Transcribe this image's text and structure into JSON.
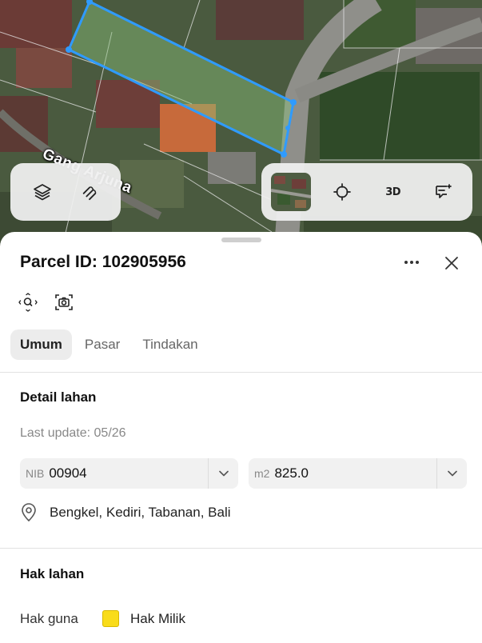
{
  "map": {
    "street_label": "Gang Arjuna",
    "parcel_color": "#2f9bff",
    "controls_left": [
      {
        "icon": "layers-icon"
      },
      {
        "icon": "draw-line-icon"
      }
    ],
    "controls_right": [
      {
        "icon": "satellite-thumbnail"
      },
      {
        "icon": "locate-icon"
      },
      {
        "text": "3D"
      },
      {
        "icon": "feedback-icon"
      }
    ]
  },
  "sheet": {
    "title": "Parcel ID: 102905956",
    "tabs": [
      {
        "label": "Umum",
        "active": true
      },
      {
        "label": "Pasar",
        "active": false
      },
      {
        "label": "Tindakan",
        "active": false
      }
    ],
    "detail": {
      "heading": "Detail lahan",
      "last_update": "Last update: 05/26",
      "nib": {
        "prefix": "NIB",
        "value": "00904"
      },
      "area": {
        "prefix": "m2",
        "value": "825.0"
      },
      "address": "Bengkel, Kediri, Tabanan, Bali"
    },
    "rights": {
      "heading": "Hak lahan",
      "label": "Hak guna",
      "value": "Hak Milik",
      "swatch_color": "#f9dc1a"
    }
  }
}
